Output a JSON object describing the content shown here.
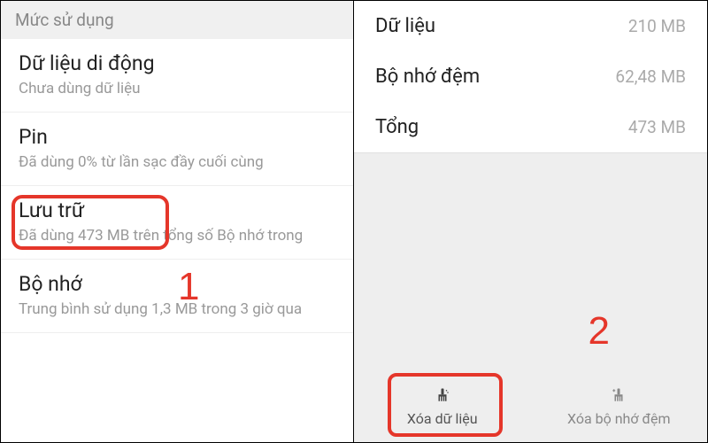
{
  "left": {
    "header": "Mức sử dụng",
    "items": [
      {
        "title": "Dữ liệu di động",
        "sub": "Chưa dùng dữ liệu"
      },
      {
        "title": "Pin",
        "sub": "Đã dùng 0% từ lần sạc đầy cuối cùng"
      },
      {
        "title": "Lưu trữ",
        "sub": "Đã dùng 473 MB trên tổng số Bộ nhớ trong"
      },
      {
        "title": "Bộ nhớ",
        "sub": "Trung bình sử dụng 1,3 MB trong 3 giờ qua"
      }
    ],
    "step_number": "1"
  },
  "right": {
    "rows": [
      {
        "label": "Dữ liệu",
        "value": "210 MB"
      },
      {
        "label": "Bộ nhớ đệm",
        "value": "62,48 MB"
      },
      {
        "label": "Tổng",
        "value": "473 MB"
      }
    ],
    "buttons": {
      "clear_data": "Xóa dữ liệu",
      "clear_cache": "Xóa bộ nhớ đệm"
    },
    "step_number": "2"
  }
}
